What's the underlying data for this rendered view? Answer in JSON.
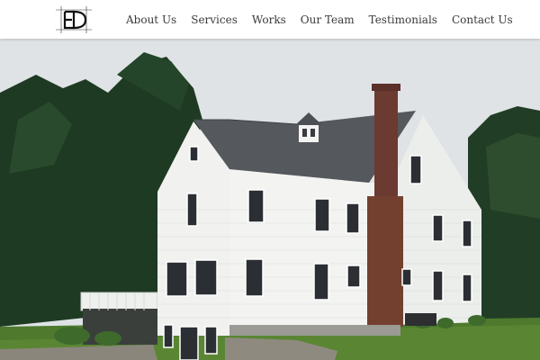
{
  "header": {
    "logo_text": "ED",
    "nav": [
      {
        "label": "About Us"
      },
      {
        "label": "Services"
      },
      {
        "label": "Works"
      },
      {
        "label": "Our Team"
      },
      {
        "label": "Testimonials"
      },
      {
        "label": "Contact Us"
      }
    ]
  },
  "hero": {
    "icon": "house-photo",
    "colors": {
      "sky": "#dfe3e6",
      "siding": "#f1f2f0",
      "roof": "#55585c",
      "chimney": "#6b3a31",
      "trees": "#1f3a22",
      "lawn": "#4f7a2e"
    }
  }
}
